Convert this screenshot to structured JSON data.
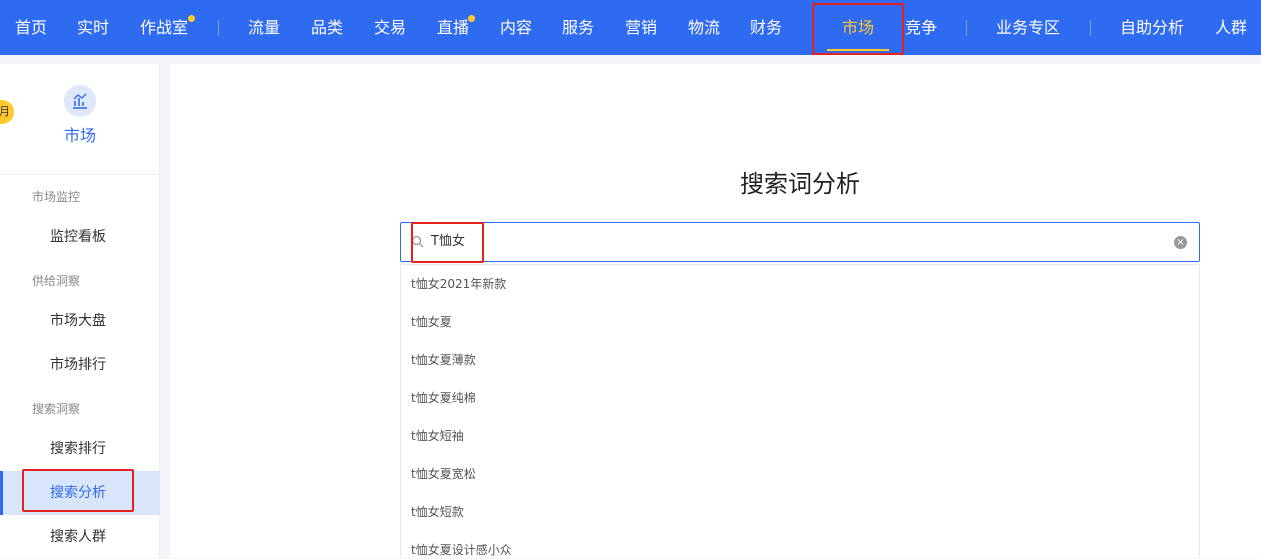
{
  "nav": {
    "items": [
      "首页",
      "实时",
      "作战室",
      "流量",
      "品类",
      "交易",
      "直播",
      "内容",
      "服务",
      "营销",
      "物流",
      "财务",
      "市场",
      "竞争",
      "业务专区",
      "自助分析",
      "人群"
    ],
    "active": "市场"
  },
  "sidebar": {
    "badge": "月",
    "title": "市场",
    "groups": [
      {
        "label": "市场监控",
        "items": [
          "监控看板"
        ]
      },
      {
        "label": "供给洞察",
        "items": [
          "市场大盘",
          "市场排行"
        ]
      },
      {
        "label": "搜索洞察",
        "items": [
          "搜索排行",
          "搜索分析",
          "搜索人群"
        ]
      }
    ],
    "active_item": "搜索分析"
  },
  "main": {
    "title": "搜索词分析",
    "search_value": "T恤女",
    "suggestions": [
      "t恤女2021年新款",
      "t恤女夏",
      "t恤女夏薄款",
      "t恤女夏纯棉",
      "t恤女短袖",
      "t恤女夏宽松",
      "t恤女短款",
      "t恤女夏设计感小众"
    ]
  },
  "colors": {
    "nav_bg": "#2f6bf0",
    "accent": "#ffc82c",
    "highlight": "#e5211d"
  }
}
